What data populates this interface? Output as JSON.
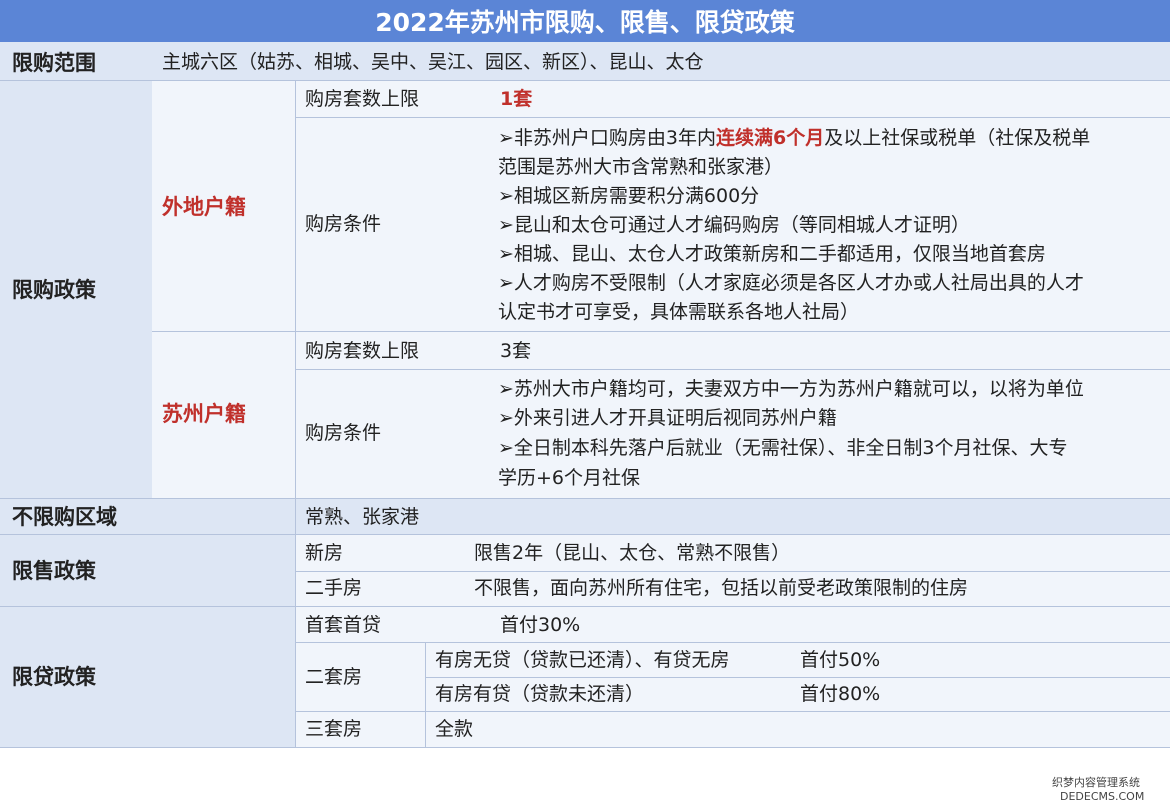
{
  "title": "2022年苏州市限购、限售、限贷政策",
  "scope": {
    "label": "限购范围",
    "value": "主城六区（姑苏、相城、吴中、吴江、园区、新区）、昆山、太仓"
  },
  "purchase_policy": {
    "label": "限购政策",
    "non_local": {
      "label": "外地户籍",
      "limit_label": "购房套数上限",
      "limit_value": "1套",
      "cond_label": "购房条件",
      "conditions": {
        "c1a": "➢非苏州户口购房由3年内",
        "c1b": "连续满6个月",
        "c1c": "及以上社保或税单（社保及税单",
        "c1d": "范围是苏州大市含常熟和张家港）",
        "c2": "➢相城区新房需要积分满600分",
        "c3": "➢昆山和太仓可通过人才编码购房（等同相城人才证明）",
        "c4": "➢相城、昆山、太仓人才政策新房和二手都适用，仅限当地首套房",
        "c5a": "➢人才购房不受限制（人才家庭必须是各区人才办或人社局出具的人才",
        "c5b": "认定书才可享受，具体需联系各地人社局）"
      }
    },
    "local": {
      "label": "苏州户籍",
      "limit_label": "购房套数上限",
      "limit_value": "3套",
      "cond_label": "购房条件",
      "conditions": {
        "c1": "➢苏州大市户籍均可，夫妻双方中一方为苏州户籍就可以，以将为单位",
        "c2": "➢外来引进人才开具证明后视同苏州户籍",
        "c3a": "➢全日制本科先落户后就业（无需社保）、非全日制3个月社保、大专",
        "c3b": "学历+6个月社保"
      }
    }
  },
  "unrestricted": {
    "label": "不限购区域",
    "value": "常熟、张家港"
  },
  "sale_policy": {
    "label": "限售政策",
    "new_label": "新房",
    "new_value": "限售2年（昆山、太仓、常熟不限售）",
    "second_label": "二手房",
    "second_value": "不限售，面向苏州所有住宅，包括以前受老政策限制的住房"
  },
  "loan_policy": {
    "label": "限贷政策",
    "first_label": "首套首贷",
    "first_value": "首付30%",
    "second_label": "二套房",
    "second_a_cond": "有房无贷（贷款已还清）、有贷无房",
    "second_a_value": "首付50%",
    "second_b_cond": "有房有贷（贷款未还清）",
    "second_b_value": "首付80%",
    "third_label": "三套房",
    "third_value": "全款"
  },
  "watermark": {
    "line1": "织梦内容管理系统",
    "line2": "DEDECMS.COM"
  },
  "colors": {
    "header_blue": "#5b85d6",
    "label_bg": "#dde6f4",
    "cell_bg": "#f1f5fb",
    "highlight_red": "#c0302b"
  }
}
